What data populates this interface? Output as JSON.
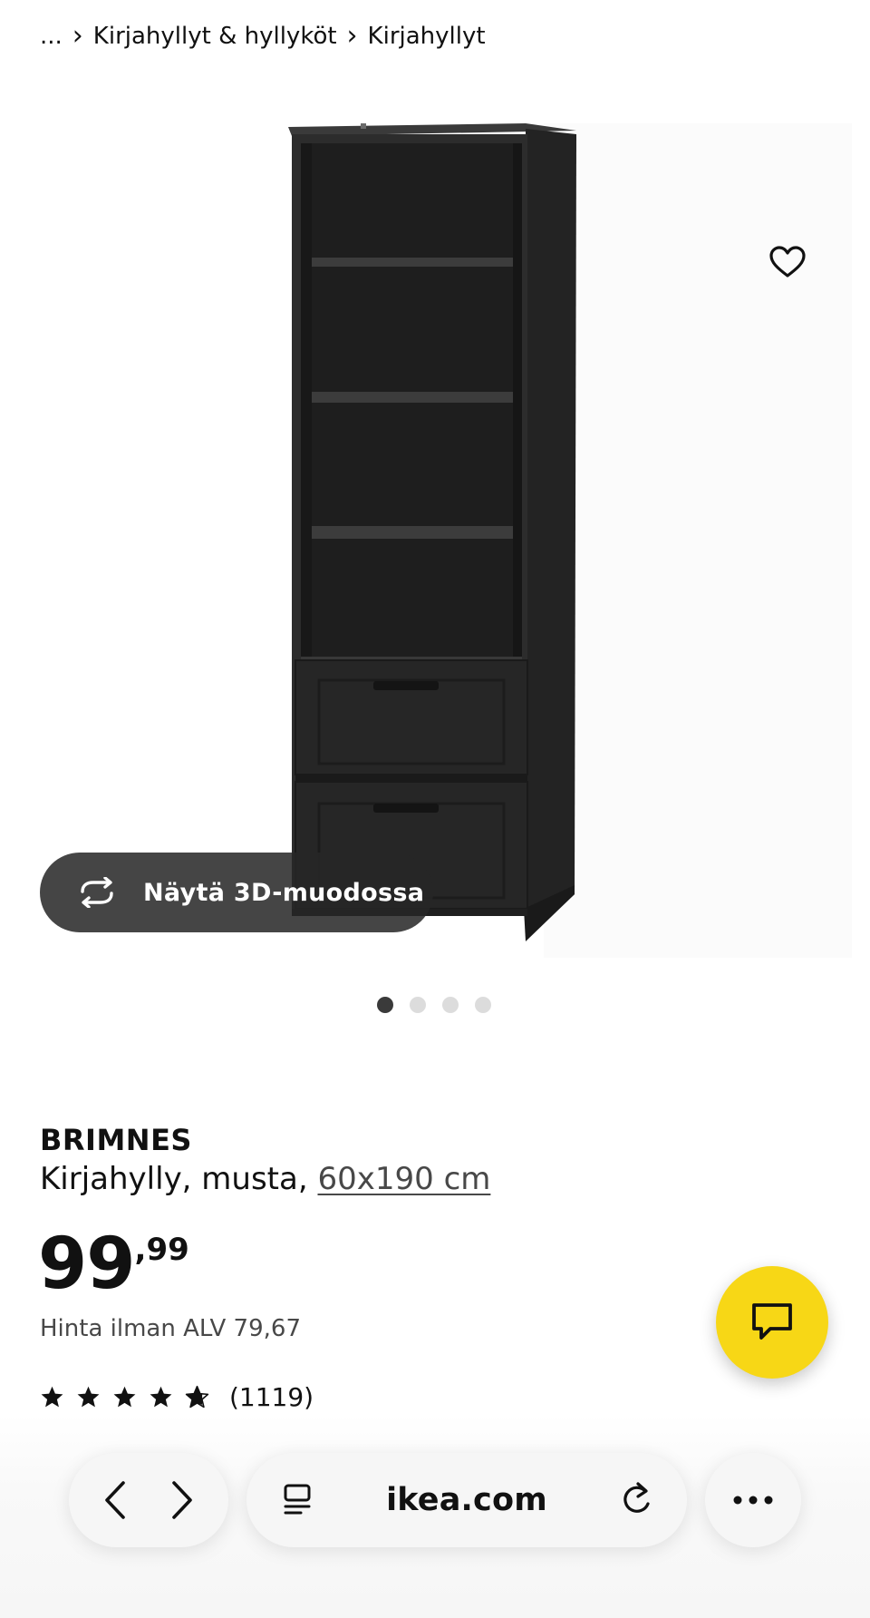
{
  "breadcrumb": {
    "ellipsis": "...",
    "items": [
      {
        "label": "Kirjahyllyt & hyllyköt"
      },
      {
        "label": "Kirjahyllyt"
      }
    ]
  },
  "gallery": {
    "view_3d_label": "Näytä 3D-muodossa",
    "image_count": 4,
    "active_index": 0
  },
  "product": {
    "name": "BRIMNES",
    "description": "Kirjahylly, musta,",
    "size": "60x190 cm",
    "price_integer": "99",
    "price_decimals": ",99",
    "vat_text": "Hinta ilman ALV 79,67",
    "rating": 4.6,
    "rating_max": 5,
    "review_count": "(1119)"
  },
  "browser": {
    "url": "ikea.com"
  },
  "colors": {
    "chat_fab": "#f7d716",
    "text": "#111111",
    "muted": "#484848",
    "product_black": "#2a2a2a"
  },
  "icons": {
    "favorite": "heart-icon",
    "view_3d": "rotate-3d-icon",
    "chat": "chat-bubble-icon",
    "back": "chevron-left-icon",
    "forward": "chevron-right-icon",
    "reader": "reader-icon",
    "reload": "reload-icon",
    "more": "more-icon"
  }
}
